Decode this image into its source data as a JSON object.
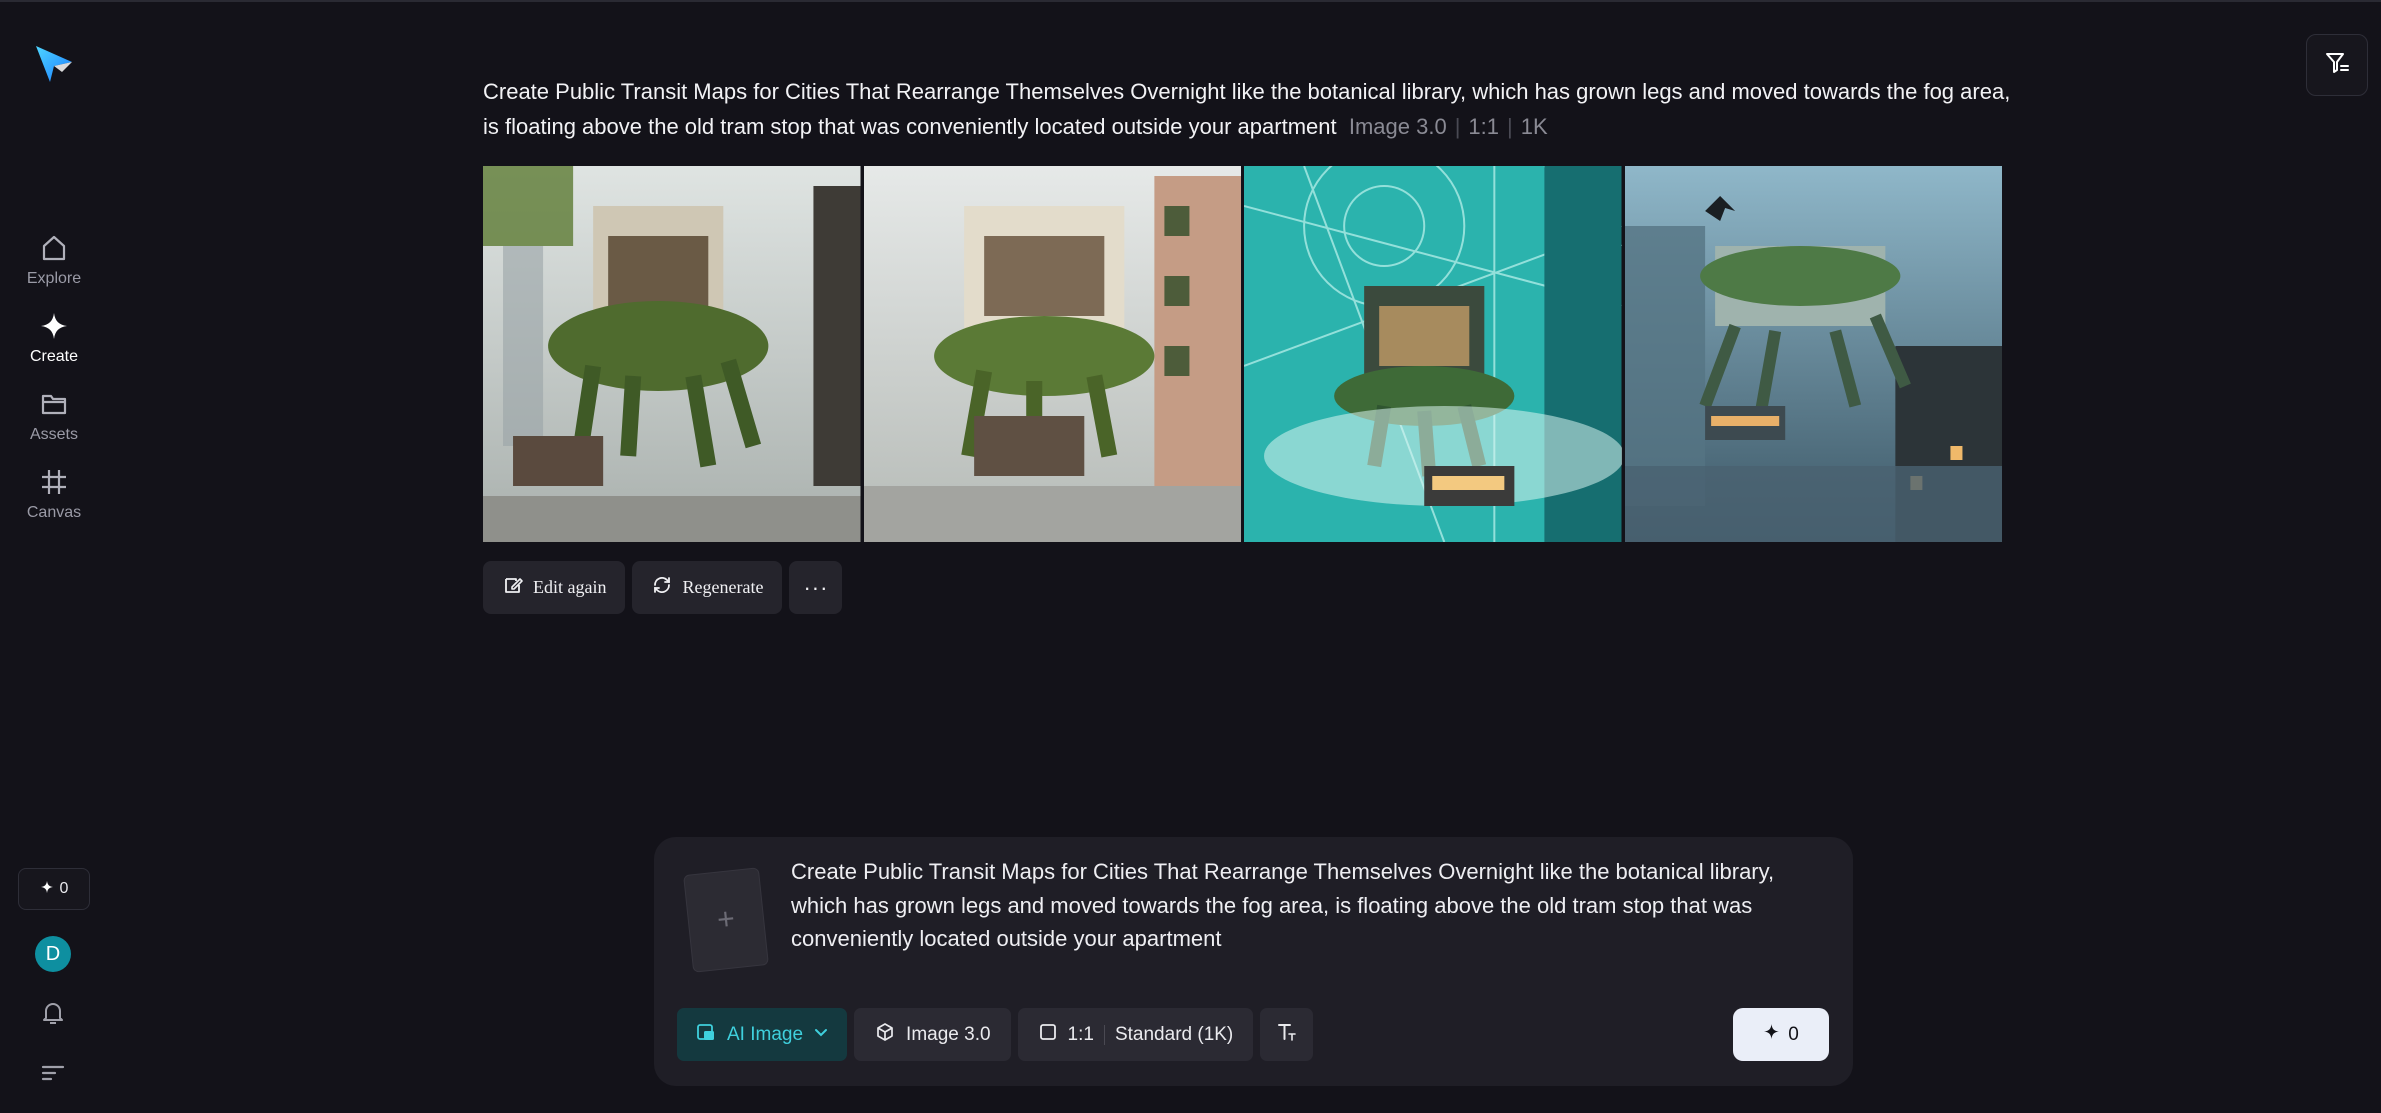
{
  "sidebar": {
    "items": [
      {
        "label": "Explore",
        "icon": "home-icon",
        "active": false
      },
      {
        "label": "Create",
        "icon": "sparkle-icon",
        "active": true
      },
      {
        "label": "Assets",
        "icon": "folder-icon",
        "active": false
      },
      {
        "label": "Canvas",
        "icon": "frame-icon",
        "active": false
      }
    ],
    "credits": "0",
    "avatar_initial": "D"
  },
  "generation": {
    "prompt": "Create Public Transit Maps for Cities That Rearrange Themselves Overnight like the botanical library, which has grown legs and moved towards the fog area, is floating above the old tram stop that was conveniently located outside your apartment",
    "model": "Image 3.0",
    "ratio": "1:1",
    "resolution": "1K",
    "images": [
      {
        "icon": "generated-image-1"
      },
      {
        "icon": "generated-image-2"
      },
      {
        "icon": "generated-image-3"
      },
      {
        "icon": "generated-image-4"
      }
    ],
    "actions": {
      "edit_again": "Edit again",
      "regenerate": "Regenerate",
      "more": "···"
    }
  },
  "composer": {
    "upload_symbol": "+",
    "prompt": "Create Public Transit Maps for Cities That Rearrange Themselves Overnight like the botanical library, which has grown legs and moved towards the fog area, is floating above the old tram stop that was conveniently located outside your apartment",
    "mode": "AI Image",
    "model": "Image 3.0",
    "ratio": "1:1",
    "quality": "Standard (1K)",
    "send_count": "0"
  },
  "colors": {
    "background": "#131219",
    "accent": "#3fd0dd",
    "avatar": "#0e8fa0"
  }
}
